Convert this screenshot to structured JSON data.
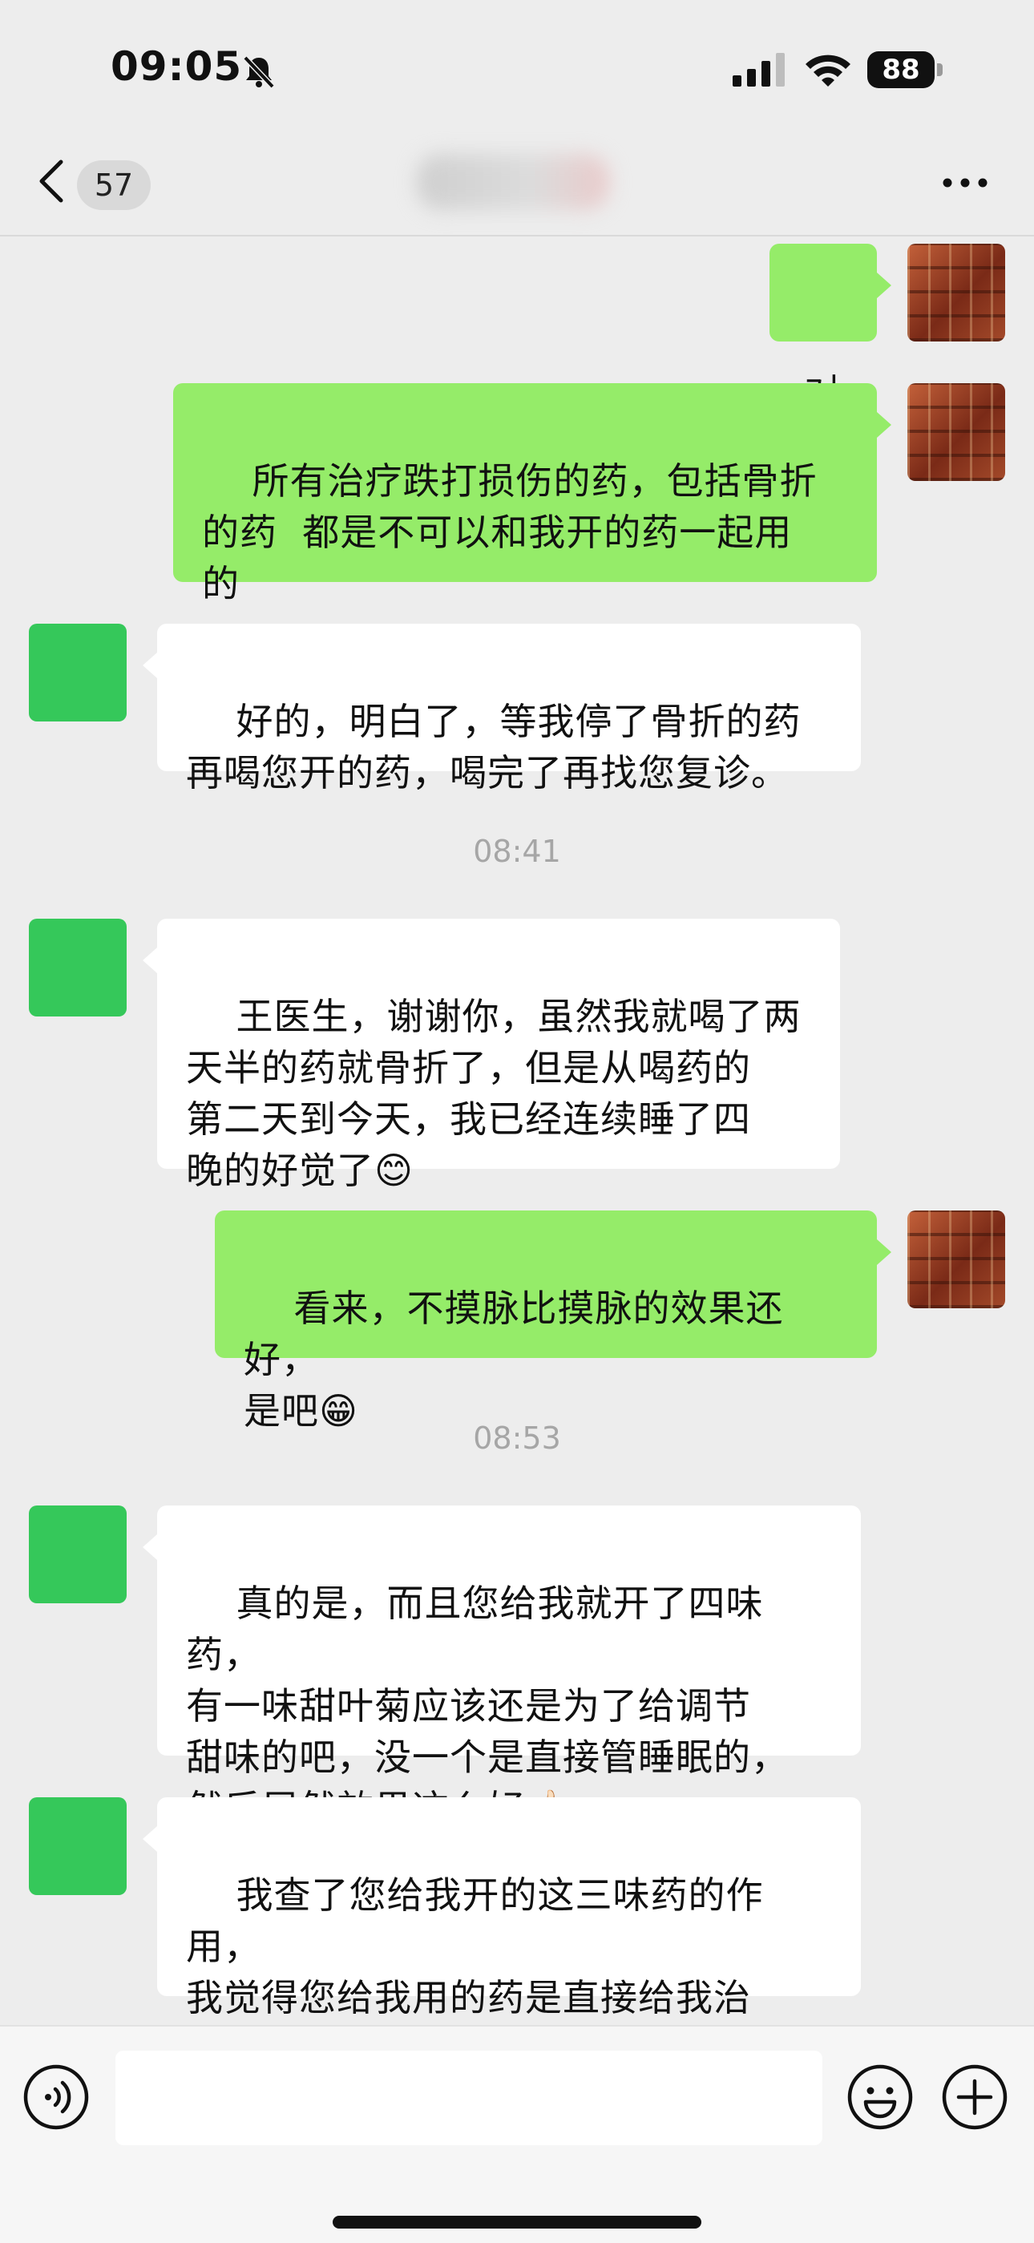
{
  "status_bar": {
    "time": "09:05",
    "battery": "88"
  },
  "nav": {
    "unread_count": "57"
  },
  "messages": [
    {
      "side": "out",
      "text": "对"
    },
    {
      "side": "out",
      "text": "所有治疗跌打损伤的药，包括骨折\n的药  都是不可以和我开的药一起用\n的"
    },
    {
      "side": "in",
      "text": "好的，明白了，等我停了骨折的药\n再喝您开的药，喝完了再找您复诊。"
    },
    {
      "type": "time",
      "text": "08:41"
    },
    {
      "side": "in",
      "text": "王医生，谢谢你，虽然我就喝了两\n天半的药就骨折了，但是从喝药的\n第二天到今天，我已经连续睡了四\n晚的好觉了",
      "emoji": "😊"
    },
    {
      "side": "out",
      "text": "看来，不摸脉比摸脉的效果还好，\n是吧",
      "emoji": "😁"
    },
    {
      "type": "time",
      "text": "08:53"
    },
    {
      "side": "in",
      "text": "真的是，而且您给我就开了四味药，\n有一味甜叶菊应该还是为了给调节\n甜味的吧，没一个是直接管睡眠的，\n然后居然效果这么好",
      "emoji": "👍🏻"
    },
    {
      "side": "in",
      "text": "我查了您给我开的这三味药的作用，\n我觉得您给我用的药是直接给我治\n到根上了，在解决我的根本问题。"
    }
  ],
  "input": {
    "value": ""
  },
  "colors": {
    "outgoing_bubble": "#95ec69",
    "incoming_bubble": "#ffffff",
    "avatar_green": "#35c85a",
    "background": "#ededed"
  }
}
